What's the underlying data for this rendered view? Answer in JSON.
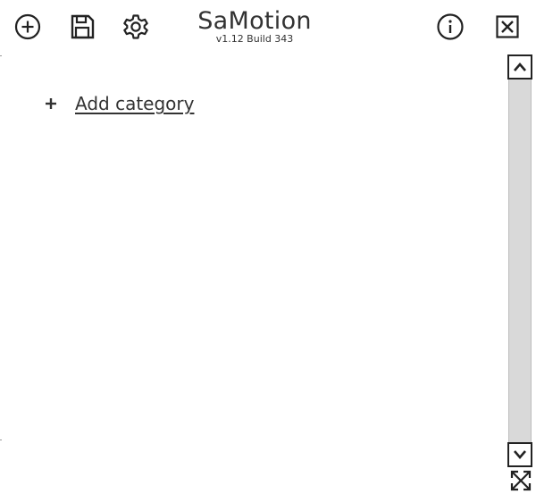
{
  "header": {
    "title": "SaMotion",
    "version": "v1.12 Build 343",
    "icons": {
      "add": "plus-circle-icon",
      "save": "save-icon",
      "settings": "gear-icon",
      "info": "info-icon",
      "close": "close-icon"
    }
  },
  "main": {
    "add_category_label": "Add category",
    "add_category_icon": "plus-icon"
  },
  "scrollbar": {
    "up_icon": "chevron-up-icon",
    "down_icon": "chevron-down-icon"
  },
  "resize_icon": "expand-icon",
  "colors": {
    "text": "#333333",
    "track": "#d9d9d9",
    "border": "#222222",
    "background": "#ffffff"
  }
}
